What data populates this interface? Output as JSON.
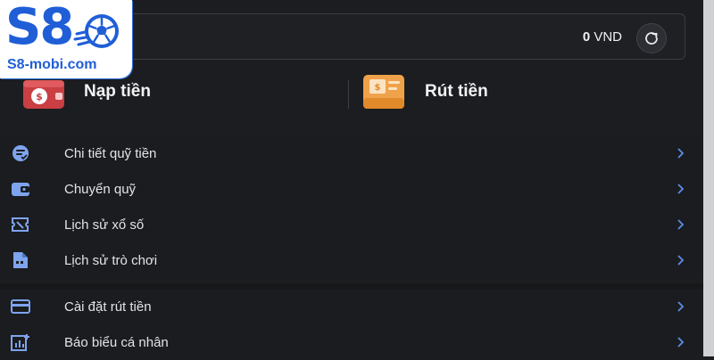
{
  "logo": {
    "text": "S8",
    "site": "S8-mobi.com"
  },
  "balance": {
    "amount": "0",
    "currency": "VND"
  },
  "actions": {
    "deposit_label": "Nạp tiền",
    "withdraw_label": "Rút tiền"
  },
  "menu": {
    "items": [
      {
        "label": "Chi tiết quỹ tiền",
        "icon": "fund-detail-icon"
      },
      {
        "label": "Chuyển quỹ",
        "icon": "wallet-icon"
      },
      {
        "label": "Lịch sử xổ số",
        "icon": "lottery-ticket-icon"
      },
      {
        "label": "Lịch sử trò chơi",
        "icon": "game-history-icon"
      },
      {
        "label": "Cài đặt rút tiền",
        "icon": "credit-card-icon"
      },
      {
        "label": "Báo biểu cá nhân",
        "icon": "report-chart-icon"
      }
    ]
  },
  "colors": {
    "accent": "#5b8ee8",
    "background": "#1c1d20",
    "logo_blue": "#1f5ed6"
  }
}
